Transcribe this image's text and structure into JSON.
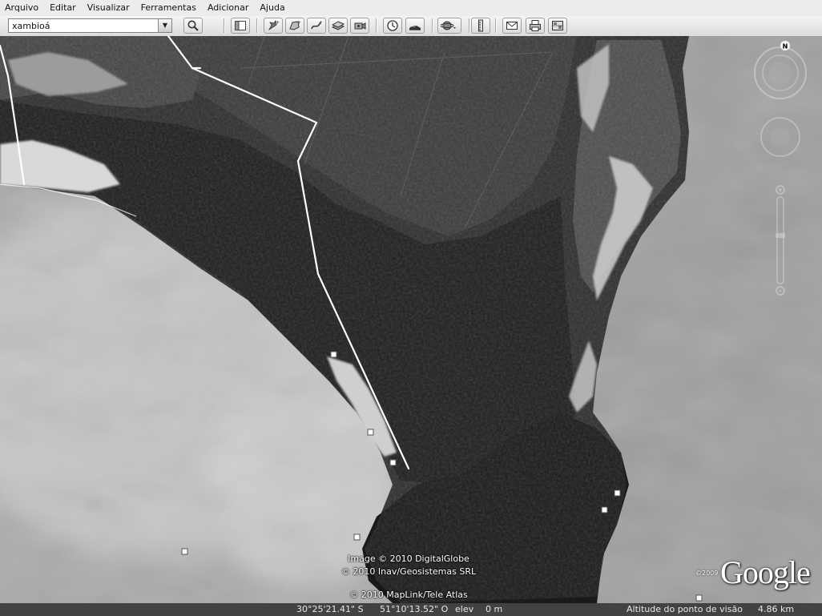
{
  "menu": {
    "items": [
      "Arquivo",
      "Editar",
      "Visualizar",
      "Ferramentas",
      "Adicionar",
      "Ajuda"
    ]
  },
  "search": {
    "value": "xambioá"
  },
  "map": {
    "credits": {
      "line1": "Image © 2010 DigitalGlobe",
      "line2": "© 2010 Inav/Geosistemas SRL",
      "line3": "© 2010 MapLink/Tele Atlas"
    },
    "logo_year": "©2009",
    "logo_text": "Google",
    "compass_label": "N"
  },
  "status": {
    "latitude": "30°25'21.41\" S",
    "longitude": "51°10'13.52\" O",
    "elev_label": "elev",
    "elev_value": "0 m",
    "eye_alt_label": "Altitude do ponto de visão",
    "eye_alt_value": "4.86 km"
  },
  "icons": [
    "search-icon",
    "sidebar-icon",
    "placemark-icon",
    "polygon-icon",
    "path-icon",
    "image-overlay-icon",
    "record-tour-icon",
    "historical-imagery-icon",
    "sunlight-icon",
    "planets-icon",
    "ruler-icon",
    "email-icon",
    "print-icon",
    "view-in-maps-icon"
  ]
}
